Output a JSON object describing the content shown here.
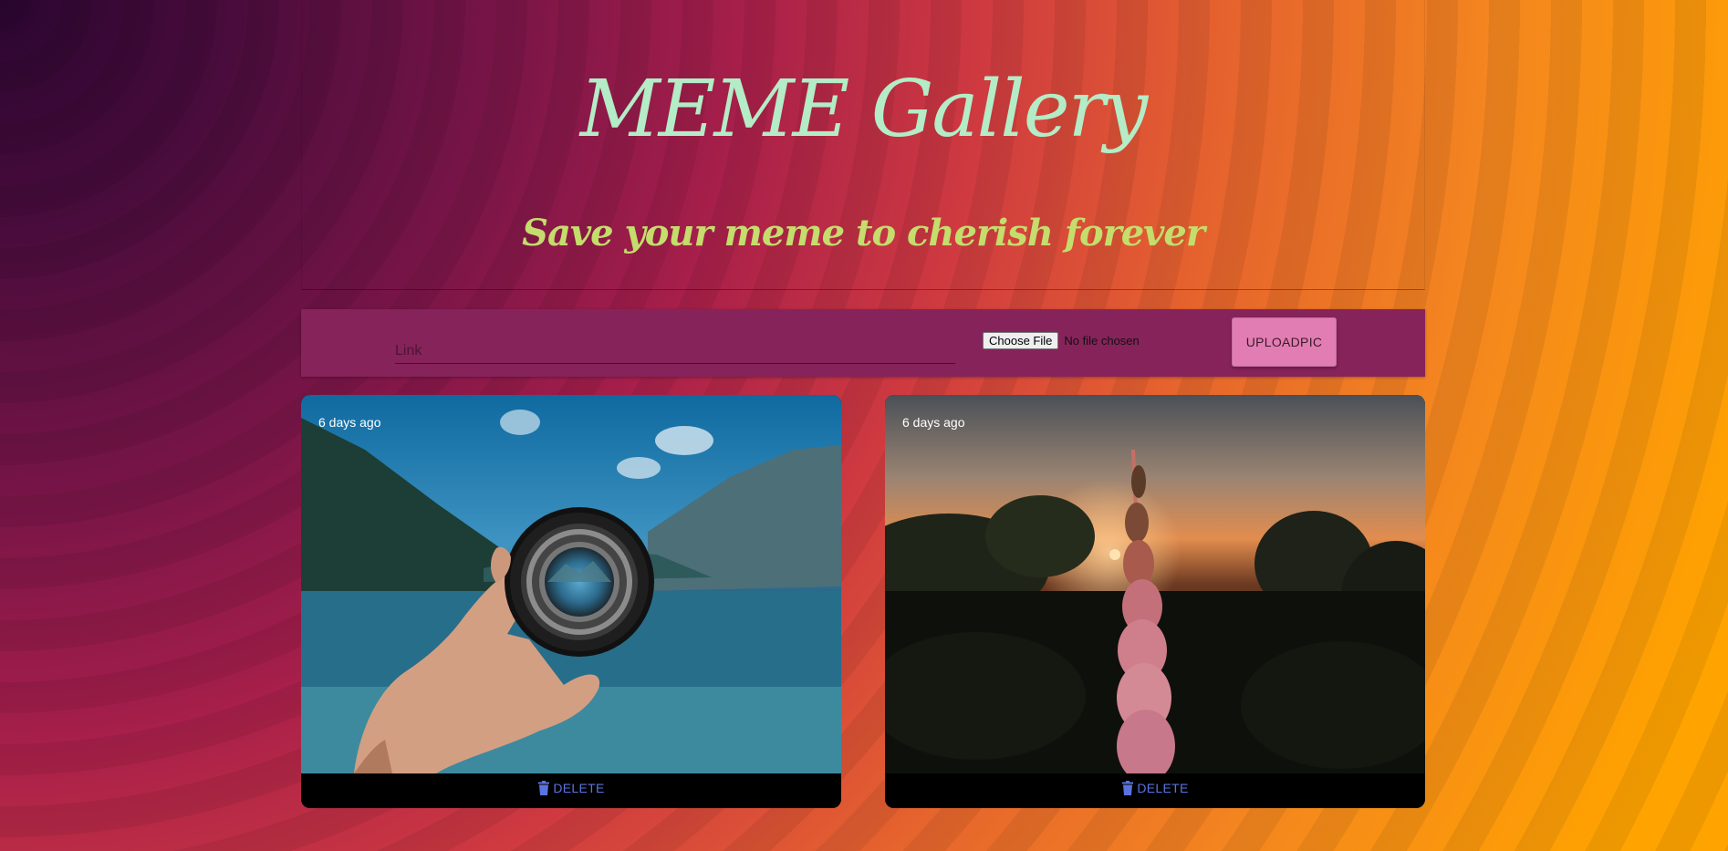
{
  "header": {
    "title": "MEME Gallery",
    "subtitle": "Save your meme to cherish forever"
  },
  "upload": {
    "link_placeholder": "Link",
    "file_button_label": "Choose File",
    "file_status": "No file chosen",
    "upload_button_label": "UPLOADPIC"
  },
  "cards": [
    {
      "timestamp": "6 days ago",
      "delete_label": "DELETE"
    },
    {
      "timestamp": "6 days ago",
      "delete_label": "DELETE"
    }
  ],
  "icons": {
    "delete": "trash-icon"
  },
  "colors": {
    "title": "#b3ecc6",
    "subtitle": "#c4dd6c",
    "upload_bar": "#86235a",
    "upload_button": "#e27db3",
    "delete_text": "#5a73e0"
  }
}
